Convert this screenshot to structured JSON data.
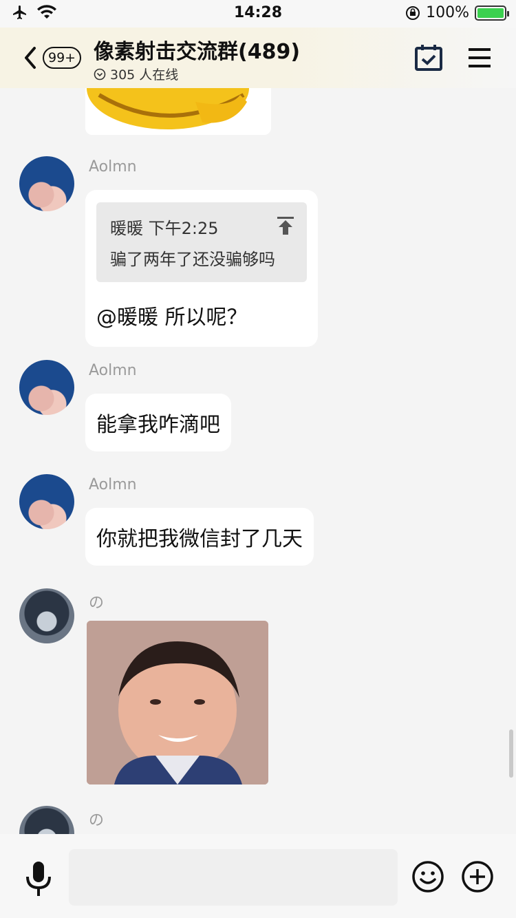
{
  "status_bar": {
    "time": "14:28",
    "battery": "100%"
  },
  "header": {
    "unread_badge": "99+",
    "title": "像素射击交流群(489)",
    "online": "305 人在线"
  },
  "messages": [
    {
      "sender": "Aolmn",
      "quote_author_time": "暖暖 下午2:25",
      "quote_text": "骗了两年了还没骗够吗",
      "text": "@暖暖 所以呢？"
    },
    {
      "sender": "Aolmn",
      "text": "能拿我咋滴吧"
    },
    {
      "sender": "Aolmn",
      "text": "你就把我微信封了几天"
    },
    {
      "sender": "の"
    },
    {
      "sender": "の"
    }
  ],
  "colors": {
    "battery_green": "#3bd14f",
    "header_tint": "#f7f3e4",
    "chat_bg": "#f4f4f4"
  }
}
